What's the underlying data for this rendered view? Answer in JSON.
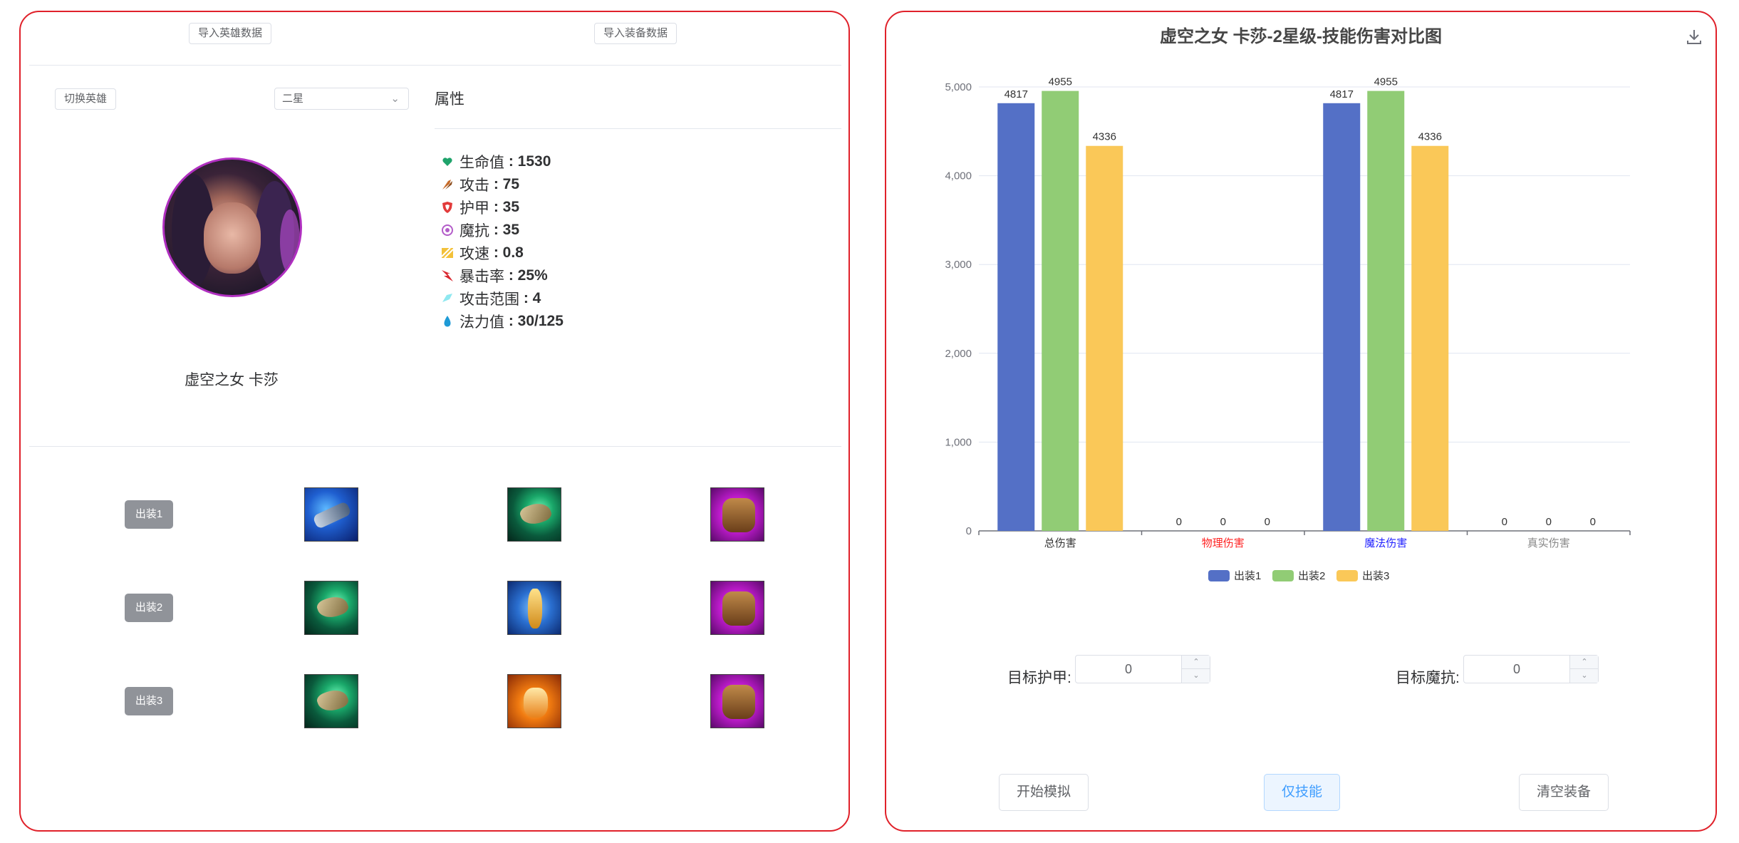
{
  "left": {
    "import_hero_label": "导入英雄数据",
    "import_items_label": "导入装备数据",
    "switch_hero_label": "切换英雄",
    "rank_selected": "二星",
    "attributes_title": "属性",
    "stats": [
      {
        "icon": "heart-icon",
        "label": "生命值",
        "value": "1530"
      },
      {
        "icon": "attack-icon",
        "label": "攻击",
        "value": "75"
      },
      {
        "icon": "armor-icon",
        "label": "护甲",
        "value": "35"
      },
      {
        "icon": "magic-resist-icon",
        "label": "魔抗",
        "value": "35"
      },
      {
        "icon": "attack-speed-icon",
        "label": "攻速",
        "value": "0.8"
      },
      {
        "icon": "crit-icon",
        "label": "暴击率",
        "value": "25%"
      },
      {
        "icon": "range-icon",
        "label": "攻击范围",
        "value": "4"
      },
      {
        "icon": "mana-icon",
        "label": "法力值",
        "value": "30/125"
      }
    ],
    "hero_name": "虚空之女 卡莎",
    "builds": [
      {
        "label": "出装1",
        "items": [
          "gun",
          "claw",
          "fist"
        ]
      },
      {
        "label": "出装2",
        "items": [
          "claw",
          "staff",
          "fist"
        ]
      },
      {
        "label": "出装3",
        "items": [
          "claw",
          "flame",
          "fist"
        ]
      }
    ]
  },
  "right": {
    "chart_title": "虚空之女 卡莎-2星级-技能伤害对比图",
    "target_armor_label": "目标护甲:",
    "target_armor_value": "0",
    "target_mr_label": "目标魔抗:",
    "target_mr_value": "0",
    "start_sim_label": "开始模拟",
    "skill_only_label": "仅技能",
    "clear_items_label": "清空装备"
  },
  "chart_data": {
    "type": "bar",
    "title": "虚空之女 卡莎-2星级-技能伤害对比图",
    "categories": [
      "总伤害",
      "物理伤害",
      "魔法伤害",
      "真实伤害"
    ],
    "category_colors": [
      "#333333",
      "#ff2222",
      "#2222ff",
      "#888888"
    ],
    "series": [
      {
        "name": "出装1",
        "color": "#5470c6",
        "values": [
          4817,
          0,
          4817,
          0
        ]
      },
      {
        "name": "出装2",
        "color": "#91cc75",
        "values": [
          4955,
          0,
          4955,
          0
        ]
      },
      {
        "name": "出装3",
        "color": "#fac858",
        "values": [
          4336,
          0,
          4336,
          0
        ]
      }
    ],
    "ylim": [
      0,
      5000
    ],
    "yticks": [
      0,
      1000,
      2000,
      3000,
      4000,
      5000
    ],
    "ytick_labels": [
      "0",
      "1,000",
      "2,000",
      "3,000",
      "4,000",
      "5,000"
    ],
    "grid": true,
    "legend_position": "bottom"
  }
}
